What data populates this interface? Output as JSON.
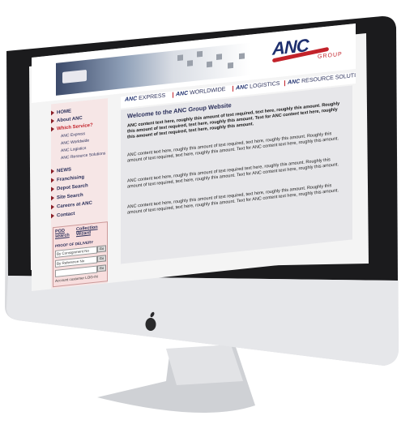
{
  "header": {
    "logo_text": "ANC",
    "logo_group": "GROUP"
  },
  "tabs": [
    {
      "brand": "ANC",
      "label": "EXPRESS"
    },
    {
      "brand": "ANC",
      "label": "WORLDWIDE"
    },
    {
      "brand": "ANC",
      "label": "LOGISTICS"
    },
    {
      "brand": "ANC",
      "label": "RESOURCE SOLUTIONS"
    }
  ],
  "sidebar": {
    "items": [
      {
        "label": "HOME"
      },
      {
        "label": "About ANC"
      },
      {
        "label": "Which Service?"
      },
      {
        "label": "NEWS"
      },
      {
        "label": "Franchising"
      },
      {
        "label": "Depot Search"
      },
      {
        "label": "Site Search"
      },
      {
        "label": "Careers at ANC"
      },
      {
        "label": "Contact"
      }
    ],
    "sub_items": [
      "ANC Express",
      "ANC Worldwide",
      "ANC Logistics",
      "ANC Resource Solutions"
    ]
  },
  "pod": {
    "pod_search": "POD search",
    "collection_wizard": "Collection Wizard",
    "proof_title": "PROOF OF DELIVERY",
    "consignment_label": "By Consignment No",
    "reference_label": "By Reference No",
    "go_label": "Go",
    "account_label": "Account customer LOG-IN"
  },
  "content": {
    "title": "Welcome to the ANC Group Website",
    "para1": "ANC content text here, roughly this amount of text required, text here, roughly this amount. Roughly this amount of text required, text here, roughly this amount. Text for ANC content text here, roughly this amount of text required, text here, roughly this amount.",
    "para2": "ANC content text here, roughly this amount of text required, text here, roughly this amount. Roughly this amount of text required, text here, roughly this amount. Text for ANC content text here, roughly this amount.",
    "para3": "ANC content text here, roughly this amount of text required text here, roughly this amount. Roughly this amount of text required, text here, roughly this amount. Text for ANC content text here, roughly this amount.",
    "para4": "ANC content text here, roughly this amount of text required, text here, roughly this amount. Roughly this amount of text required, text here, roughly this amount. Text for ANC content text here, roughly this amount."
  },
  "colors": {
    "brand_navy": "#1e2f6e",
    "brand_red": "#c2222a",
    "bezel": "#1b1b1d",
    "chin": "#e4e5e8"
  },
  "icons": [
    "apple-logo-icon",
    "arrow-bullet-icon"
  ]
}
